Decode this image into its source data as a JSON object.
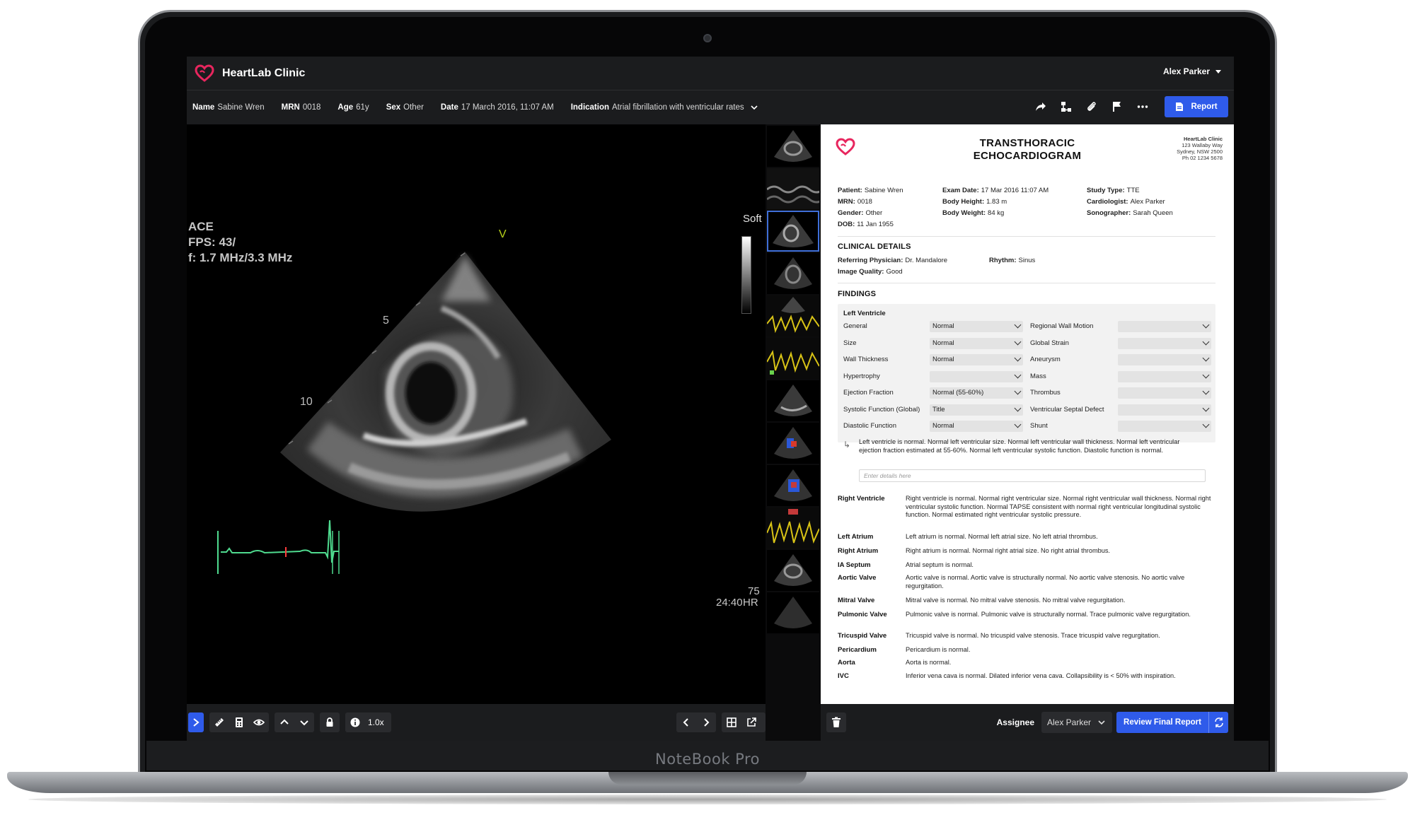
{
  "device": {
    "brand_label": "NoteBook Pro"
  },
  "app": {
    "title": "HeartLab Clinic",
    "brand_color": "#e8265e",
    "accent_color": "#2f5bea"
  },
  "user": {
    "name": "Alex Parker"
  },
  "patient_bar": {
    "name_label": "Name",
    "name": "Sabine Wren",
    "mrn_label": "MRN",
    "mrn": "0018",
    "age_label": "Age",
    "age": "61y",
    "sex_label": "Sex",
    "sex": "Other",
    "date_label": "Date",
    "date": "17 March 2016, 11:07 AM",
    "indication_label": "Indication",
    "indication": "Atrial fibrillation with ventricular rates"
  },
  "toolbar": {
    "icons": [
      "share-icon",
      "hierarchy-icon",
      "paperclip-icon",
      "flag-icon",
      "more-icon"
    ],
    "report_label": "Report"
  },
  "viewer": {
    "mode": "ACE",
    "fps": "FPS: 43/",
    "frequency": "f: 1.7 MHz/3.3 MHz",
    "soft_label": "Soft",
    "depth_5": "5",
    "depth_10": "10",
    "marker": "V",
    "hr_value": "75",
    "time": "24:40",
    "hr_label": "HR",
    "zoom": "1.0x"
  },
  "report": {
    "title_line1": "TRANSTHORACIC",
    "title_line2": "ECHOCARDIOGRAM",
    "clinic": {
      "name": "HeartLab Clinic",
      "street": "123 Wallaby Way",
      "city": "Sydney, NSW 2500",
      "phone": "Ph 02 1234 5678"
    },
    "patient_info": {
      "patient_label": "Patient:",
      "patient": "Sabine Wren",
      "mrn_label": "MRN:",
      "mrn": "0018",
      "gender_label": "Gender:",
      "gender": "Other",
      "dob_label": "DOB:",
      "dob": "11 Jan 1955",
      "exam_date_label": "Exam Date:",
      "exam_date": "17 Mar 2016 11:07 AM",
      "height_label": "Body Height:",
      "height": "1.83 m",
      "weight_label": "Body Weight:",
      "weight": "84 kg",
      "study_type_label": "Study Type:",
      "study_type": "TTE",
      "cardiologist_label": "Cardiologist:",
      "cardiologist": "Alex Parker",
      "sonographer_label": "Sonographer:",
      "sonographer": "Sarah Queen"
    },
    "clinical_details": {
      "heading": "CLINICAL DETAILS",
      "referring_label": "Referring Physician:",
      "referring": "Dr. Mandalore",
      "rhythm_label": "Rhythm:",
      "rhythm": "Sinus",
      "quality_label": "Image Quality:",
      "quality": "Good"
    },
    "findings_heading": "FINDINGS",
    "left_ventricle": {
      "title": "Left Ventricle",
      "left_rows": [
        {
          "label": "General",
          "value": "Normal"
        },
        {
          "label": "Size",
          "value": "Normal"
        },
        {
          "label": "Wall Thickness",
          "value": "Normal"
        },
        {
          "label": "Hypertrophy",
          "value": ""
        },
        {
          "label": "Ejection Fraction",
          "value": "Normal (55-60%)"
        },
        {
          "label": "Systolic Function (Global)",
          "value": "Title"
        },
        {
          "label": "Diastolic Function",
          "value": "Normal"
        }
      ],
      "right_rows": [
        {
          "label": "Regional Wall Motion",
          "value": ""
        },
        {
          "label": "Global Strain",
          "value": ""
        },
        {
          "label": "Aneurysm",
          "value": ""
        },
        {
          "label": "Mass",
          "value": ""
        },
        {
          "label": "Thrombus",
          "value": ""
        },
        {
          "label": "Ventricular Septal Defect",
          "value": ""
        },
        {
          "label": "Shunt",
          "value": ""
        }
      ],
      "summary": "Left ventricle is normal. Normal left ventricular size. Normal left ventricular wall thickness. Normal left ventricular ejection fraction estimated at 55-60%. Normal left ventricular systolic function. Diastolic function is normal.",
      "details_placeholder": "Enter details here"
    },
    "findings": [
      {
        "label": "Right Ventricle",
        "text": "Right ventricle is normal. Normal right ventricular size. Normal right ventricular wall thickness. Normal right ventricular systolic function. Normal TAPSE consistent with normal right ventricular longitudinal systolic function. Normal estimated right ventricular systolic pressure."
      },
      {
        "label": "Left Atrium",
        "text": "Left atrium is normal. Normal left atrial size. No left atrial thrombus."
      },
      {
        "label": "Right Atrium",
        "text": "Right atrium is normal. Normal right atrial size. No right atrial thrombus."
      },
      {
        "label": "IA Septum",
        "text": "Atrial septum is normal."
      },
      {
        "label": "Aortic Valve",
        "text": "Aortic valve is normal. Aortic valve is structurally normal. No aortic valve stenosis. No aortic valve regurgitation."
      },
      {
        "label": "Mitral Valve",
        "text": "Mitral valve is normal. No mitral valve stenosis. No mitral valve regurgitation."
      },
      {
        "label": "Pulmonic Valve",
        "text": "Pulmonic valve is normal. Pulmonic valve is structurally normal. Trace pulmonic valve regurgitation."
      },
      {
        "label": "Tricuspid Valve",
        "text": "Tricuspid valve is normal. No tricuspid valve stenosis. Trace tricuspid valve regurgitation."
      },
      {
        "label": "Pericardium",
        "text": "Pericardium is normal."
      },
      {
        "label": "Aorta",
        "text": "Aorta is normal."
      },
      {
        "label": "IVC",
        "text": "Inferior vena cava is normal. Dilated inferior vena cava. Collapsibility is < 50% with inspiration."
      }
    ]
  },
  "report_toolbar": {
    "assignee_label": "Assignee",
    "assignee": "Alex Parker",
    "review_label": "Review Final Report"
  }
}
